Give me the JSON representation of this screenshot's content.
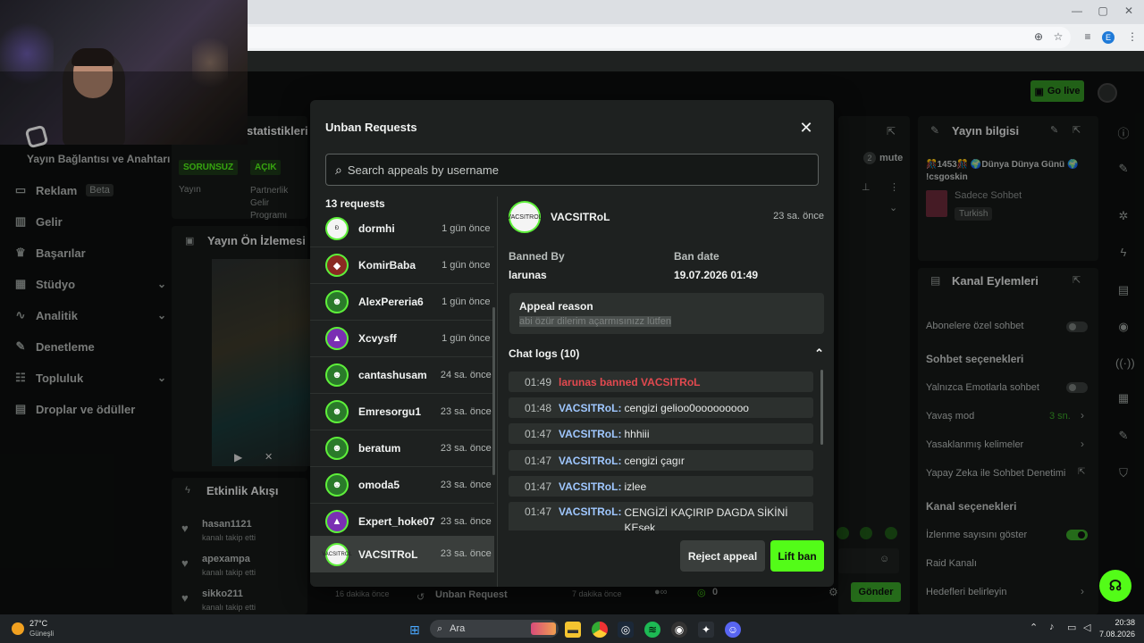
{
  "modal": {
    "title": "Unban Requests",
    "search_placeholder": "Search appeals by username",
    "request_count": "13 requests",
    "requests": [
      {
        "name": "dormhi",
        "time": "1 gün önce"
      },
      {
        "name": "KomirBaba",
        "time": "1 gün önce"
      },
      {
        "name": "AlexPereria6",
        "time": "1 gün önce"
      },
      {
        "name": "Xcvysff",
        "time": "1 gün önce"
      },
      {
        "name": "cantashusam",
        "time": "24 sa. önce"
      },
      {
        "name": "Emresorgu1",
        "time": "23 sa. önce"
      },
      {
        "name": "beratum",
        "time": "23 sa. önce"
      },
      {
        "name": "omoda5",
        "time": "23 sa. önce"
      },
      {
        "name": "Expert_hoke07",
        "time": "23 sa. önce"
      },
      {
        "name": "VACSITRoL",
        "time": "23 sa. önce"
      }
    ],
    "detail": {
      "username": "VACSITRoL",
      "time": "23 sa. önce",
      "avatar_text": "VACSITROL",
      "banned_by_label": "Banned By",
      "banned_by": "larunas",
      "ban_date_label": "Ban date",
      "ban_date": "19.07.2026 01:49",
      "appeal_reason_label": "Appeal reason",
      "appeal_reason": "abi özür dilerim açarmısınızz lütfen",
      "chat_logs_label": "Chat logs (10)",
      "chat_logs": [
        {
          "time": "01:49",
          "user": "",
          "text": "larunas banned VACSITRoL"
        },
        {
          "time": "01:48",
          "user": "VACSITRoL:",
          "text": "cengizi gelioo0ooooooooo"
        },
        {
          "time": "01:47",
          "user": "VACSITRoL:",
          "text": "hhhiii"
        },
        {
          "time": "01:47",
          "user": "VACSITRoL:",
          "text": "cengizi çagır"
        },
        {
          "time": "01:47",
          "user": "VACSITRoL:",
          "text": "izlee"
        },
        {
          "time": "01:47",
          "user": "VACSITRoL:",
          "text": "CENGİZİ KAÇIRIP DAGDA SİKİNİ KEsek"
        }
      ],
      "reject_label": "Reject appeal",
      "lift_label": "Lift ban"
    }
  },
  "sidebar": {
    "connection_label": "Yayın Bağlantısı ve Anahtarı",
    "items": [
      {
        "label": "Reklam",
        "badge": "Beta",
        "icon": "monitor-icon"
      },
      {
        "label": "Gelir",
        "icon": "chart-icon"
      },
      {
        "label": "Başarılar",
        "icon": "trophy-icon"
      },
      {
        "label": "Stüdyo",
        "icon": "studio-icon"
      },
      {
        "label": "Analitik",
        "icon": "analytics-icon"
      },
      {
        "label": "Denetleme",
        "icon": "wrench-icon"
      },
      {
        "label": "Topluluk",
        "icon": "community-icon"
      },
      {
        "label": "Droplar ve ödüller",
        "icon": "drops-icon"
      }
    ]
  },
  "dashboard": {
    "stats_title": "statistikleri",
    "tag_sorunsuz": "SORUNSUZ",
    "tag_acik": "AÇIK",
    "col_yayin": "Yayın",
    "col_partnerlik": "Partnerlik Gelir Programı",
    "preview_title": "Yayın Ön İzlemesi",
    "activity_title": "Etkinlik Akışı",
    "activity": [
      {
        "user": "hasan1121",
        "sub": "kanalı takip etti"
      },
      {
        "user": "apexampa",
        "sub": "kanalı takip etti"
      },
      {
        "user": "sikko211",
        "sub": "kanalı takip etti",
        "time": "16 dakika önce"
      }
    ],
    "unban_footer": "Unban Request",
    "unban_footer_time": "7 dakika önce",
    "mute_label": "mute",
    "send_label": "Gönder",
    "viewer_count": "0"
  },
  "right": {
    "go_live": "Go live",
    "stream_info_title": "Yayın bilgisi",
    "stream_title": "🎊1453🎊 🌍Dünya Dünya Günü 🌍 !csgoskin",
    "category": "Sadece Sohbet",
    "language": "Turkish",
    "channel_actions_title": "Kanal Eylemleri",
    "subscriber_chat": "Abonelere özel sohbet",
    "chat_options_title": "Sohbet seçenekleri",
    "emotes_only": "Yalnızca Emotlarla sohbet",
    "slow_mode": "Yavaş mod",
    "slow_mode_value": "3 sn.",
    "banned_words": "Yasaklanmış kelimeler",
    "ai_moderation": "Yapay Zeka ile Sohbet Denetimi",
    "channel_options_title": "Kanal seçenekleri",
    "show_viewers": "İzlenme sayısını göster",
    "raid_channel": "Raid Kanalı",
    "set_goals": "Hedefleri belirleyin"
  },
  "taskbar": {
    "weather_temp": "27°C",
    "weather_desc": "Güneşli",
    "search_label": "Ara",
    "clock_time": "20:38",
    "clock_date": "7.08.2026"
  },
  "colors": {
    "accent": "#53fc18",
    "danger": "#e2494f",
    "username": "#9fc7ff",
    "modal_bg": "#1e2120"
  }
}
